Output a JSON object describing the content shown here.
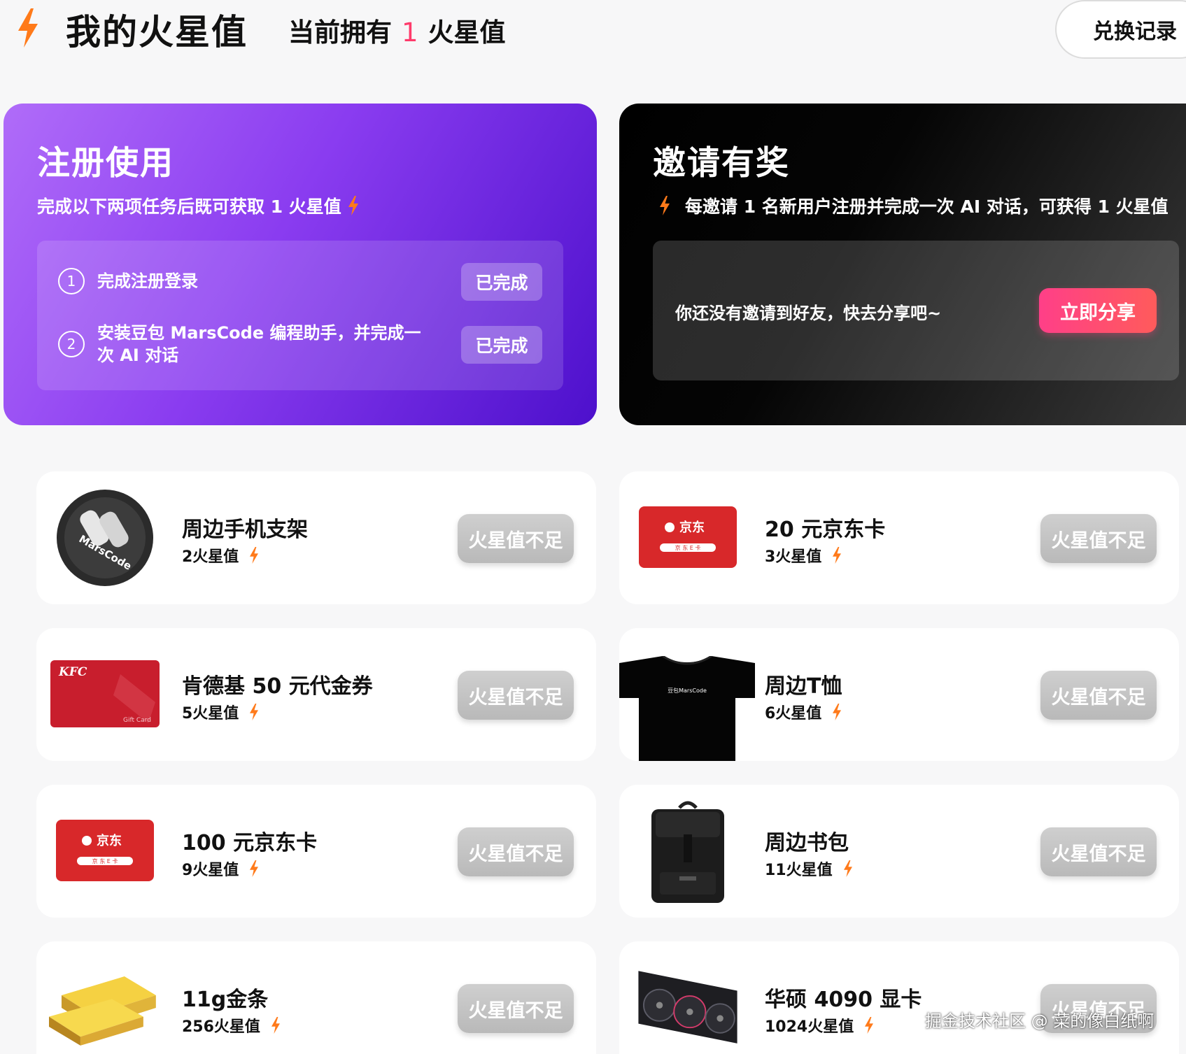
{
  "header": {
    "title": "我的火星值",
    "balance_prefix": "当前拥有",
    "balance_value": "1",
    "balance_suffix": "火星值",
    "exchange_label": "兑换记录"
  },
  "register_card": {
    "title": "注册使用",
    "subtitle": "完成以下两项任务后既可获取 1 火星值",
    "tasks": [
      {
        "num": "1",
        "label": "完成注册登录",
        "status": "已完成"
      },
      {
        "num": "2",
        "label": "安装豆包 MarsCode 编程助手，并完成一次 AI 对话",
        "status": "已完成"
      }
    ]
  },
  "invite_card": {
    "title": "邀请有奖",
    "subtitle": "每邀请 1 名新用户注册并完成一次 AI 对话，可获得 1 火星值",
    "empty_text": "你还没有邀请到好友，快去分享吧~",
    "share_label": "立即分享"
  },
  "products": [
    {
      "name": "周边手机支架",
      "price": "2火星值",
      "button": "火星值不足",
      "image": "marscode-phone-stand"
    },
    {
      "name": "20 元京东卡",
      "price": "3火星值",
      "button": "火星值不足",
      "image": "jd-card"
    },
    {
      "name": "肯德基 50 元代金券",
      "price": "5火星值",
      "button": "火星值不足",
      "image": "kfc-gift-card"
    },
    {
      "name": "周边T恤",
      "price": "6火星值",
      "button": "火星值不足",
      "image": "black-tshirt"
    },
    {
      "name": "100 元京东卡",
      "price": "9火星值",
      "button": "火星值不足",
      "image": "jd-card"
    },
    {
      "name": "周边书包",
      "price": "11火星值",
      "button": "火星值不足",
      "image": "backpack"
    },
    {
      "name": "11g金条",
      "price": "256火星值",
      "button": "火星值不足",
      "image": "gold-bar"
    },
    {
      "name": "华硕 4090 显卡",
      "price": "1024火星值",
      "button": "火星值不足",
      "image": "graphics-card"
    }
  ],
  "image_text": {
    "marscode_logo": "MarsCode",
    "jd_brand": "京东",
    "jd_card_label": "京 东 E 卡",
    "kfc_brand": "KFC",
    "kfc_gift": "Gift Card",
    "tshirt_print": "豆包MarsCode"
  },
  "watermark": "掘金技术社区 @ 菜的像白纸啊",
  "colors": {
    "accent_bolt": "#ff7a1a",
    "balance_number": "#ff3b6b",
    "register_gradient_start": "#b06cf9",
    "register_gradient_end": "#4d10cc",
    "share_button": "#ff3f88",
    "insufficient_button": "#c4c4c4"
  },
  "icons": [
    "lightning-bolt-icon"
  ]
}
